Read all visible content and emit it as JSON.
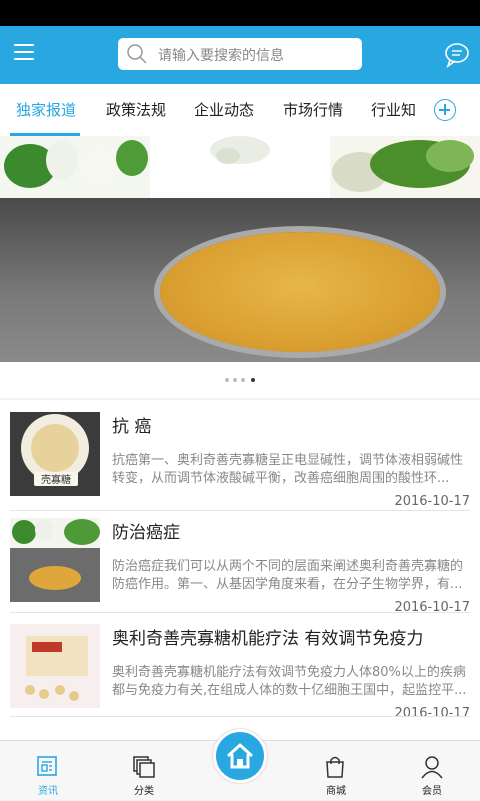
{
  "search": {
    "placeholder": "请输入要搜索的信息"
  },
  "tabs": [
    {
      "label": "独家报道",
      "active": true
    },
    {
      "label": "政策法规"
    },
    {
      "label": "企业动态"
    },
    {
      "label": "市场行情"
    },
    {
      "label": "行业知"
    }
  ],
  "banner": {
    "slides": 4,
    "current": 4
  },
  "articles": [
    {
      "title": "抗 癌",
      "desc": "抗癌第一、奥利奇善壳寡糖呈正电显碱性，调节体液相弱碱性转变，从而调节体液酸碱平衡，改善癌细胞周围的酸性环...",
      "date": "2016-10-17",
      "thumb_label": "壳寡糖"
    },
    {
      "title": "防治癌症",
      "desc": "防治癌症我们可以从两个不同的层面来阐述奥利奇善壳寡糖的防癌作用。第一、从基因学角度来看，在分子生物学界，有...",
      "date": "2016-10-17"
    },
    {
      "title": "奥利奇善壳寡糖机能疗法 有效调节免疫力",
      "desc": "奥利奇善壳寡糖机能疗法有效调节免疫力人体80%以上的疾病都与免疫力有关,在组成人体的数十亿细胞王国中，起监控平...",
      "date": "2016-10-17"
    }
  ],
  "bottom_nav": [
    {
      "label": "资讯",
      "icon": "news-icon",
      "active": true
    },
    {
      "label": "分类",
      "icon": "category-icon"
    },
    {
      "label": "",
      "icon": "home-icon"
    },
    {
      "label": "商城",
      "icon": "shopping-bag-icon"
    },
    {
      "label": "会员",
      "icon": "user-icon"
    }
  ],
  "colors": {
    "accent": "#29a7e1"
  }
}
